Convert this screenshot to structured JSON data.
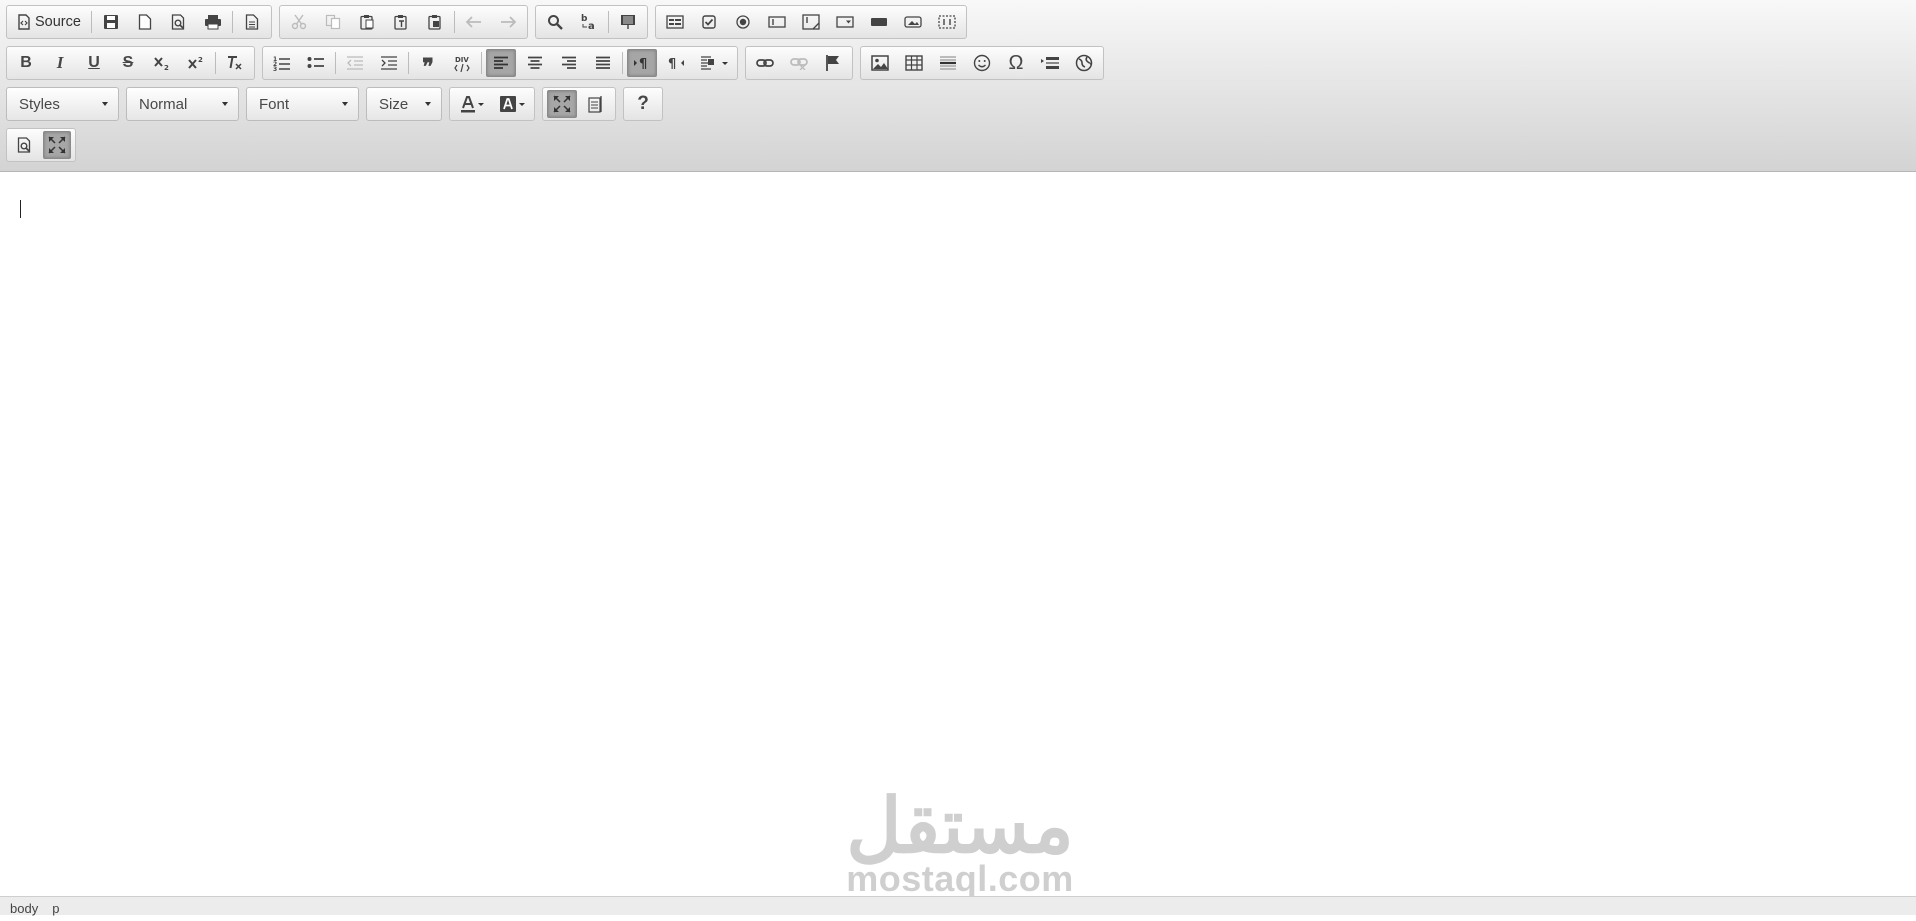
{
  "toolbar": {
    "source_label": "Source",
    "combos": {
      "styles": "Styles",
      "format": "Normal",
      "font": "Font",
      "size": "Size"
    },
    "help_glyph": "?",
    "special_char_glyph": "Ω",
    "div_glyph": "DIV"
  },
  "editor": {
    "content": ""
  },
  "watermark": {
    "arabic": "مستقل",
    "latin": "mostaql.com"
  },
  "statusbar": {
    "path": [
      "body",
      "p"
    ]
  }
}
